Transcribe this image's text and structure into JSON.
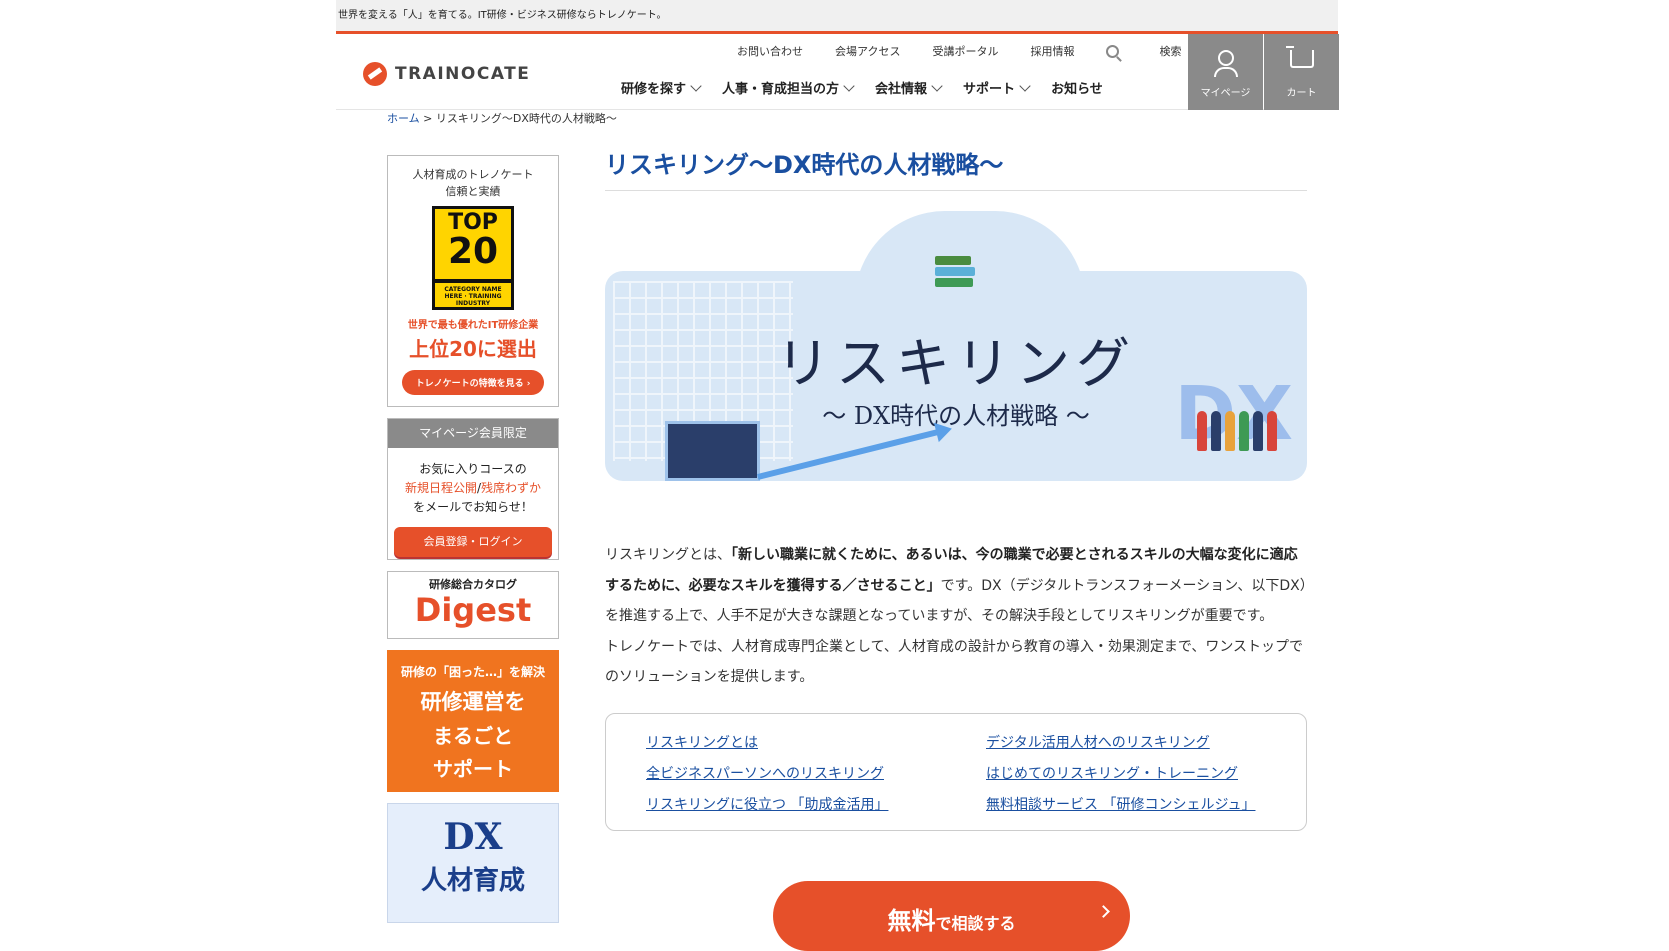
{
  "topbar": {
    "tagline": "世界を変える「人」を育てる。IT研修・ビジネス研修ならトレノケート。"
  },
  "brand": {
    "logo_text": "TRAINOCATE",
    "accent": "#e6502a",
    "link_color": "#1a4fa0"
  },
  "util_nav": [
    "お問い合わせ",
    "会場アクセス",
    "受講ポータル",
    "採用情報",
    "検索"
  ],
  "global_nav": [
    "研修を探す",
    "人事・育成担当の方",
    "会社情報",
    "サポート",
    "お知らせ"
  ],
  "header_buttons": {
    "mypage": "マイページ",
    "cart": "カート"
  },
  "breadcrumb": {
    "home": "ホーム",
    "sep": " > ",
    "current": "リスキリング〜DX時代の人材戦略〜"
  },
  "sidebar": {
    "banner1": {
      "cap1": "人材育成のトレノケート",
      "cap2": "信頼と実績",
      "badge_top": "TOP",
      "badge_num": "20",
      "badge_small": "CATEGORY NAME HERE · TRAINING INDUSTRY",
      "red1": "世界で最も優れたIT研修企業",
      "red2": "上位20に選出",
      "button": "トレノケートの特徴を見る ›"
    },
    "banner2": {
      "head": "マイページ会員限定",
      "line1": "お気に入りコースの",
      "orange_a": "新規日程公開",
      "slash": "/",
      "orange_b": "残席わずか",
      "line3": "をメールでお知らせ！",
      "button": "会員登録・ログイン"
    },
    "banner3": {
      "small": "研修総合カタログ",
      "big": "Digest"
    },
    "banner4": {
      "a": "研修の「困った…」を解決",
      "b": "研修運営を",
      "c1": "まるごと",
      "c2": "サポート"
    },
    "banner5": {
      "a": "DX",
      "b": "人材育成"
    }
  },
  "main": {
    "title": "リスキリング〜DX時代の人材戦略〜",
    "hero": {
      "big": "リスキリング",
      "sub": "〜 DX時代の人材戦略 〜",
      "dx": "DX"
    },
    "intro": {
      "p1_a": "リスキリングとは、",
      "p1_b": "「新しい職業に就くために、あるいは、今の職業で必要とされるスキルの大幅な変化に適応するために、必要なスキルを獲得する／させること」",
      "p1_c": "です。DX（デジタルトランスフォーメーション、以下DX）を推進する上で、人手不足が大きな課題となっていますが、その解決手段としてリスキリングが重要です。",
      "p2": "トレノケートでは、人材育成専門企業として、人材育成の設計から教育の導入・効果測定まで、ワンストップでのソリューションを提供します。"
    },
    "links_left": [
      "リスキリングとは",
      "全ビジネスパーソンへのリスキリング",
      "リスキリングに役立つ 「助成金活用」"
    ],
    "links_right": [
      "デジタル活用人材へのリスキリング",
      "はじめてのリスキリング・トレーニング",
      "無料相談サービス 「研修コンシェルジュ」"
    ],
    "cta": {
      "big": "無料",
      "small": "で相談する"
    }
  }
}
